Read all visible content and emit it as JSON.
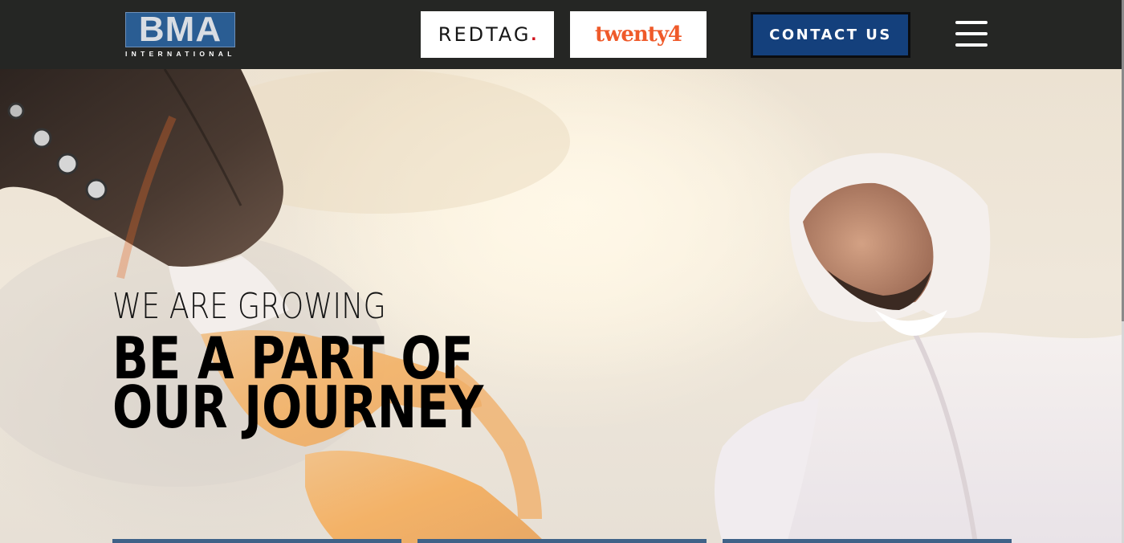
{
  "header": {
    "logo": {
      "letters": "BMA",
      "subtitle": "INTERNATIONAL",
      "colors": {
        "box": "#2a5d93",
        "letters": "#d9dde3"
      }
    },
    "brands": [
      {
        "name": "REDTAG",
        "dot": ".",
        "color": "#161616",
        "dot_color": "#d0111b"
      },
      {
        "name": "twenty4",
        "color": "#ef5a2a"
      }
    ],
    "contact_label": "CONTACT US",
    "menu_icon": "hamburger-menu-icon",
    "colors": {
      "background": "#252624",
      "contact_button": "#14407c"
    }
  },
  "hero": {
    "kicker": "WE ARE GROWING",
    "title_line1": "BE A PART OF",
    "title_line2": "OUR JOURNEY",
    "image": "handshake-photo",
    "colors": {
      "card_strip": "#3f6288"
    }
  }
}
